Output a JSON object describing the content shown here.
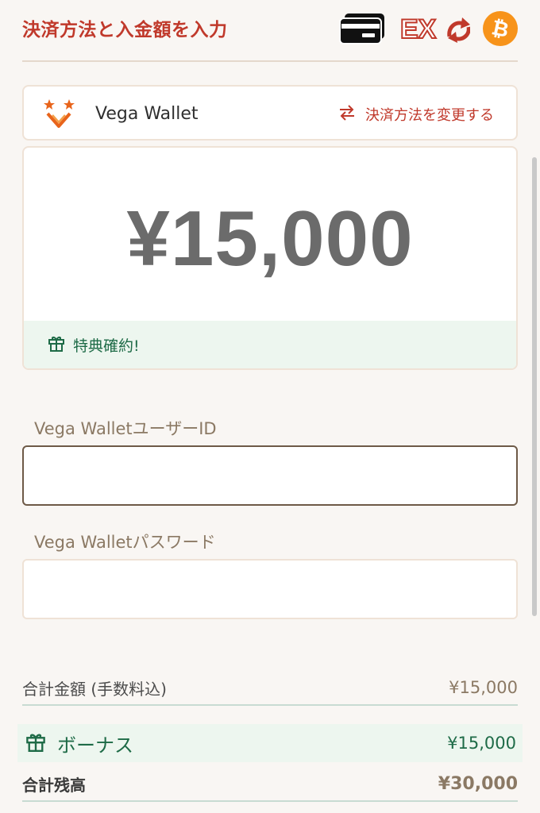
{
  "header": {
    "title": "決済方法と入金額を入力",
    "icons": [
      "credit-card-icon",
      "ex-exchange-icon",
      "bitcoin-icon"
    ],
    "ex_text": "EX",
    "accent_color": "#c0392b"
  },
  "method": {
    "name": "Vega Wallet",
    "change_label": "決済方法を変更する",
    "logo_icon": "vega-wallet-logo"
  },
  "amount": {
    "value": "¥15,000",
    "perk_label": "特典確約!"
  },
  "form": {
    "user_id_label": "Vega WalletユーザーID",
    "user_id_value": "",
    "password_label": "Vega Walletパスワード",
    "password_value": ""
  },
  "summary": {
    "total_label": "合計金額 (手数料込)",
    "total_value": "¥15,000",
    "bonus_label": "ボーナス",
    "bonus_value": "¥15,000",
    "balance_label": "合計残高",
    "balance_value": "¥30,000"
  },
  "colors": {
    "green": "#1e6b47",
    "bonus_bg": "#edf6ef",
    "bitcoin": "#f7931a"
  }
}
